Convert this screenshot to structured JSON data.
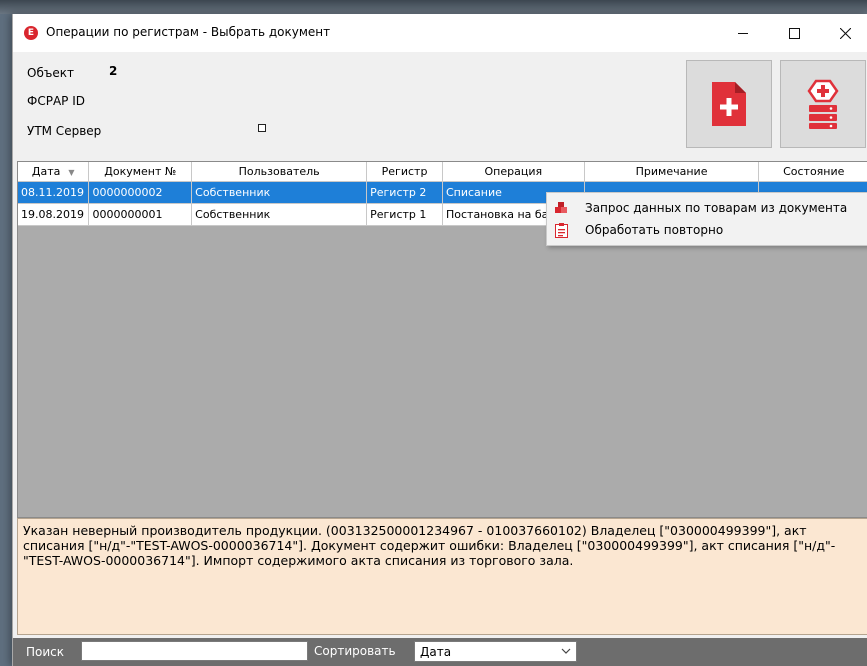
{
  "window": {
    "title": "Операции по регистрам - Выбрать документ",
    "app_icon_letter": "E"
  },
  "info": {
    "object_label": "Объект",
    "object_value": "2",
    "fsrar_label": "ФСРАР ID",
    "utm_label": "УТМ Сервер"
  },
  "toolbar": {
    "new_doc_icon": "new-document-icon",
    "server_icon": "server-add-icon"
  },
  "table": {
    "columns": [
      "Дата",
      "Документ №",
      "Пользователь",
      "Регистр",
      "Операция",
      "Примечание",
      "Состояние"
    ],
    "rows": [
      [
        "08.11.2019",
        "0000000002",
        "Собственник",
        "Регистр 2",
        "Списание",
        "",
        ""
      ],
      [
        "19.08.2019",
        "0000000001",
        "Собственник",
        "Регистр 1",
        "Постановка на ба",
        "",
        ""
      ]
    ],
    "selected_row": 0,
    "selection_color": "#1e7fd8"
  },
  "context_menu": {
    "items": [
      {
        "label": "Запрос данных по товарам  из документа",
        "icon": "boxes-icon"
      },
      {
        "label": "Обработать повторно",
        "icon": "clipboard-icon"
      }
    ]
  },
  "message": "Указан неверный производитель продукции. (003132500001234967 - 010037660102) Владелец [\"030000499399\"], акт списания [\"н/д\"-\"TEST-AWOS-0000036714\"].  Документ содержит ошибки:  Владелец [\"030000499399\"], акт списания [\"н/д\"-\"TEST-AWOS-0000036714\"]. Импорт содержимого акта списания из торгового зала.",
  "bottom": {
    "search_label": "Поиск",
    "search_value": "",
    "sort_label": "Сортировать",
    "sort_value": "Дата"
  },
  "colors": {
    "accent_red": "#d9262e",
    "message_bg": "#fbe7d2"
  }
}
